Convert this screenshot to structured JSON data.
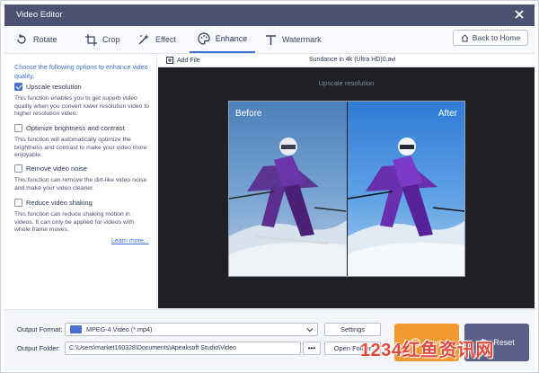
{
  "window": {
    "title": "Video Editor"
  },
  "tabs": [
    {
      "label": "Rotate",
      "icon": "rotate-icon"
    },
    {
      "label": "Crop",
      "icon": "crop-icon"
    },
    {
      "label": "Effect",
      "icon": "effect-icon"
    },
    {
      "label": "Enhance",
      "icon": "palette-icon",
      "active": true
    },
    {
      "label": "Watermark",
      "icon": "text-icon"
    }
  ],
  "toolbar": {
    "back_home": "Back to Home"
  },
  "enhance": {
    "intro": "Choose the following options to enhance video quality.",
    "options": [
      {
        "label": "Upscale resolution",
        "checked": true,
        "description": "This function enables you to get superb video quality when you convert lower resolution video to higher resolution video."
      },
      {
        "label": "Optimize brightness and contrast",
        "checked": false,
        "description": "This function will automatically optimize the brightness and contrast to make your video more enjoyable."
      },
      {
        "label": "Remove video noise",
        "checked": false,
        "description": "This function can remove the dirt-like video noise and make your video cleaner."
      },
      {
        "label": "Reduce video shaking",
        "checked": false,
        "description": "This function can reduce shaking motion in videos. It can only be applied for videos with whole frame moves."
      }
    ],
    "learn_more": "Learn more..."
  },
  "preview": {
    "add_file": "Add File",
    "filename": "Sundance in 4k (Ultra HD)0.avi",
    "mode_label": "Upscale resolution",
    "before_label": "Before",
    "after_label": "After"
  },
  "output": {
    "format_label": "Output Format:",
    "format_value": "MPEG-4 Video (*.mp4)",
    "settings": "Settings",
    "folder_label": "Output Folder:",
    "folder_value": "C:\\Users\\market160328\\Documents\\Apeaksoft Studio\\Video",
    "browse": "•••",
    "open_folder": "Open Folder",
    "save": "Save",
    "reset": "Reset"
  },
  "overlay_watermark": "1234红鱼资讯网",
  "colors": {
    "accent": "#3f6fcf",
    "titlebar": "#4b5170",
    "save": "#f29a2e",
    "reset": "#5a5f87"
  }
}
